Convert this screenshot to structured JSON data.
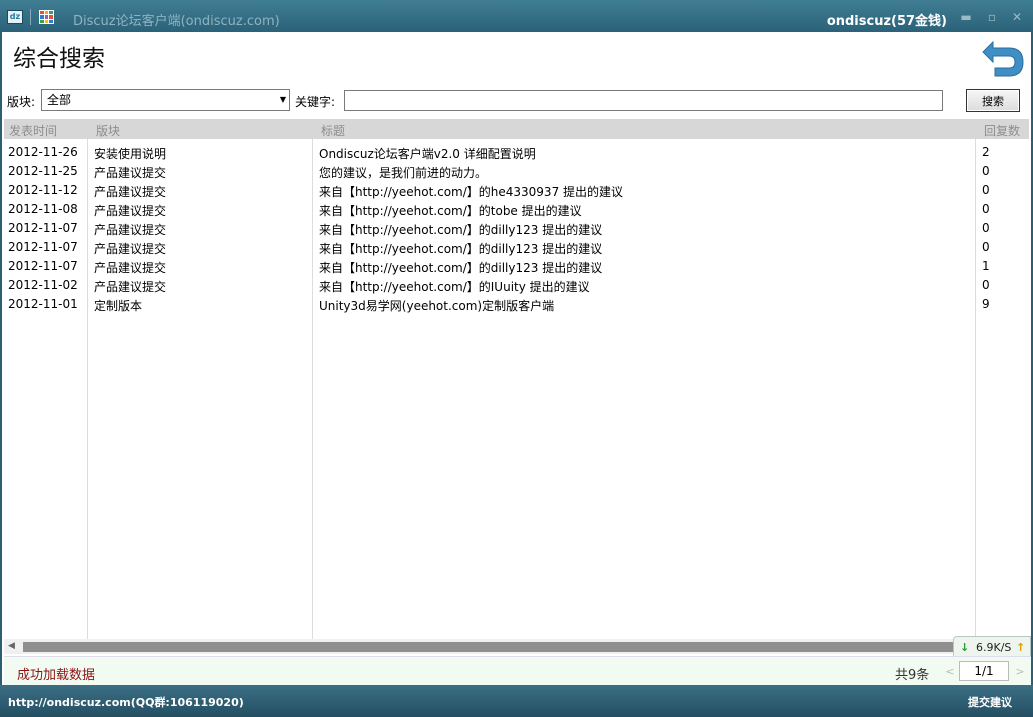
{
  "window": {
    "title": "Discuz论坛客户端(ondiscuz.com)",
    "user": "ondiscuz(57金钱)",
    "minimize": "▬",
    "maximize": "▫",
    "close": "✕"
  },
  "page": {
    "title": "综合搜索"
  },
  "filters": {
    "board_label": "版块:",
    "board_value": "全部",
    "keyword_label": "关键字:",
    "keyword_value": "",
    "search_button": "搜索"
  },
  "table": {
    "headers": {
      "time": "发表时间",
      "board": "版块",
      "title": "标题",
      "replies": "回复数"
    },
    "rows": [
      {
        "time": "2012-11-26",
        "board": "安装使用说明",
        "title": "Ondiscuz论坛客户端v2.0 详细配置说明",
        "replies": "2"
      },
      {
        "time": "2012-11-25",
        "board": "产品建议提交",
        "title": "您的建议，是我们前进的动力。",
        "replies": "0"
      },
      {
        "time": "2012-11-12",
        "board": "产品建议提交",
        "title": "来自【http://yeehot.com/】的he4330937 提出的建议",
        "replies": "0"
      },
      {
        "time": "2012-11-08",
        "board": "产品建议提交",
        "title": "来自【http://yeehot.com/】的tobe 提出的建议",
        "replies": "0"
      },
      {
        "time": "2012-11-07",
        "board": "产品建议提交",
        "title": "来自【http://yeehot.com/】的dilly123 提出的建议",
        "replies": "0"
      },
      {
        "time": "2012-11-07",
        "board": "产品建议提交",
        "title": "来自【http://yeehot.com/】的dilly123 提出的建议",
        "replies": "0"
      },
      {
        "time": "2012-11-07",
        "board": "产品建议提交",
        "title": "来自【http://yeehot.com/】的dilly123 提出的建议",
        "replies": "1"
      },
      {
        "time": "2012-11-02",
        "board": "产品建议提交",
        "title": "来自【http://yeehot.com/】的IUuity 提出的建议",
        "replies": "0"
      },
      {
        "time": "2012-11-01",
        "board": "定制版本",
        "title": "Unity3d易学网(yeehot.com)定制版客户端",
        "replies": "9"
      }
    ]
  },
  "speed": {
    "value": "6.9K/S"
  },
  "status": {
    "message": "成功加载数据",
    "total": "共9条",
    "page": "1/1",
    "prev": "<",
    "next": ">"
  },
  "footer": {
    "link": "http://ondiscuz.com(QQ群:106119020)",
    "suggest": "提交建议"
  },
  "colors": {
    "titlebar": "#2b6279",
    "status_error_text": "#8a1414",
    "back_arrow": "#3f8fc4"
  }
}
